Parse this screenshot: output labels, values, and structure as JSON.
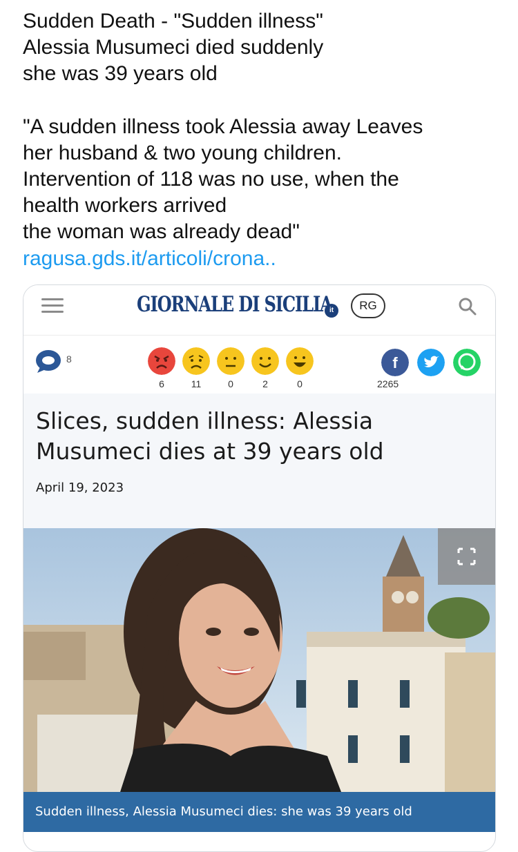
{
  "tweet": {
    "lines": [
      "Sudden Death - \"Sudden illness\"",
      "Alessia Musumeci died suddenly",
      "she was 39 years old",
      "\"A sudden illness took Alessia away Leaves",
      "her husband & two young children.",
      "Intervention of 118 was no use, when the",
      "health workers arrived",
      "the woman was already dead\""
    ],
    "link": "ragusa.gds.it/articoli/crona.."
  },
  "site": {
    "logo": "GIORNALE DI SICILIA",
    "logo_suffix": "it",
    "badge": "RG"
  },
  "reactions": {
    "comment_count": "8",
    "emojis": [
      {
        "icon": "angry-face-icon",
        "count": "6",
        "color": "#e8463c"
      },
      {
        "icon": "sad-face-icon",
        "count": "11",
        "color": "#f7c51e"
      },
      {
        "icon": "neutral-face-icon",
        "count": "0",
        "color": "#f7c51e"
      },
      {
        "icon": "smile-face-icon",
        "count": "2",
        "color": "#f7c51e"
      },
      {
        "icon": "grin-face-icon",
        "count": "0",
        "color": "#f7c51e"
      }
    ],
    "share_count": "2265",
    "social": {
      "facebook": "#3b5998",
      "twitter": "#1da1f2",
      "whatsapp": "#25d366"
    }
  },
  "article": {
    "headline": "Slices, sudden illness: Alessia Musumeci dies at 39 years old",
    "date": "April 19, 2023",
    "caption": "Sudden illness, Alessia Musumeci dies: she was 39 years old"
  }
}
